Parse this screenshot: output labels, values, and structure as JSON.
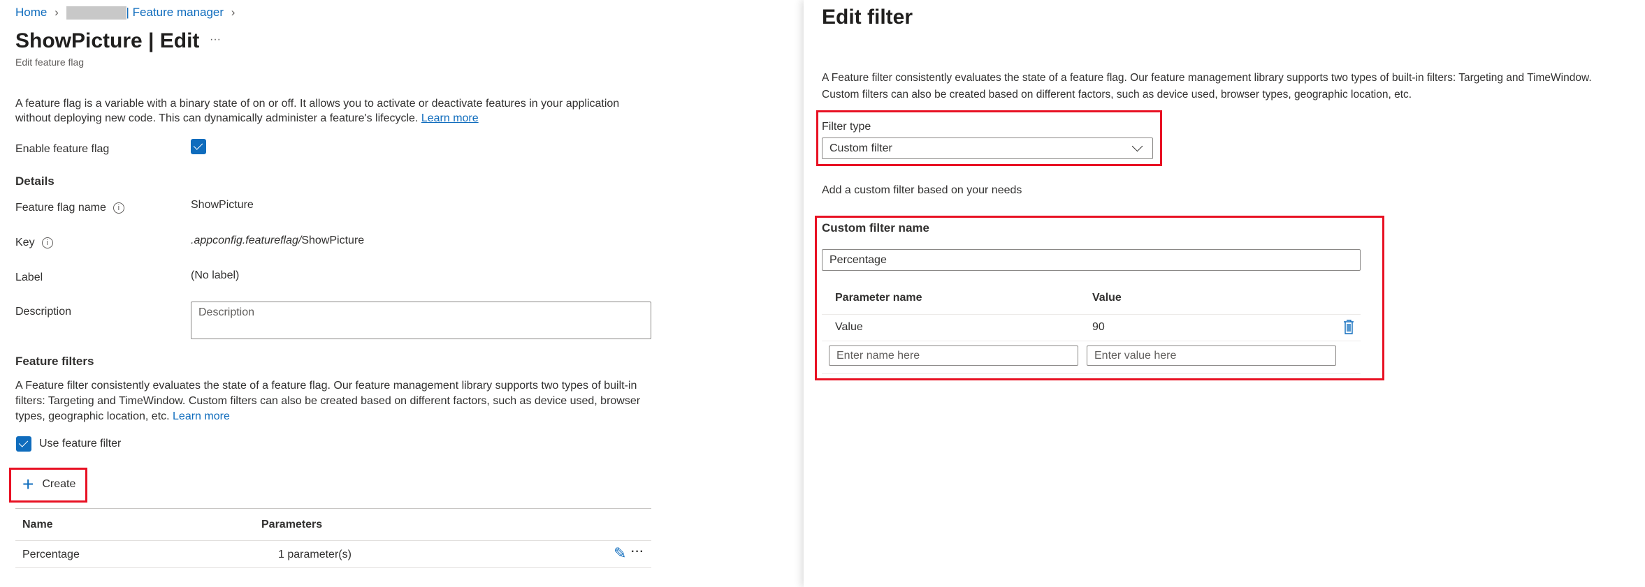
{
  "breadcrumb": {
    "home": "Home",
    "redacted": "",
    "feature_manager": "| Feature manager"
  },
  "header": {
    "title": "ShowPicture | Edit",
    "more": "···",
    "subtitle": "Edit feature flag"
  },
  "intro": {
    "text": "A feature flag is a variable with a binary state of on or off. It allows you to activate or deactivate features in your application",
    "text2": "without deploying new code. This can dynamically administer a feature's lifecycle. ",
    "learn_more": "Learn more"
  },
  "enable": {
    "label": "Enable feature flag",
    "checked": true
  },
  "details": {
    "heading": "Details",
    "name_label": "Feature flag name",
    "name_value": "ShowPicture",
    "key_label": "Key",
    "key_prefix": ".appconfig.featureflag/",
    "key_value": "ShowPicture",
    "label_label": "Label",
    "label_value": "(No label)",
    "desc_label": "Description",
    "desc_placeholder": "Description"
  },
  "filters": {
    "heading": "Feature filters",
    "line1": "A Feature filter consistently evaluates the state of a feature flag. Our feature management library supports two types of built-in",
    "line2": "filters: Targeting and TimeWindow. Custom filters can also be created based on different factors, such as device used, browser",
    "line3": "types, geographic location, etc. ",
    "learn_more": "Learn more",
    "use_label": "Use feature filter",
    "use_checked": true,
    "create": "Create",
    "columns": [
      "Name",
      "Parameters"
    ],
    "rows": [
      {
        "name": "Percentage",
        "params": "1 parameter(s)"
      }
    ]
  },
  "panel": {
    "title": "Edit filter",
    "desc1": "A Feature filter consistently evaluates the state of a feature flag. Our feature management library supports two types of built-in filters: Targeting and TimeWindow.",
    "desc2": "Custom filters can also be created based on different factors, such as device used, browser types, geographic location, etc.",
    "filter_type_label": "Filter type",
    "filter_type_value": "Custom filter",
    "hint": "Add a custom filter based on your needs",
    "custom_name_label": "Custom filter name",
    "custom_name_value": "Percentage",
    "param_columns": [
      "Parameter name",
      "Value"
    ],
    "params": [
      {
        "name": "Value",
        "value": "90"
      }
    ],
    "name_placeholder": "Enter name here",
    "value_placeholder": "Enter value here"
  },
  "colors": {
    "accent": "#0f6cbd",
    "highlight": "#e81123"
  }
}
